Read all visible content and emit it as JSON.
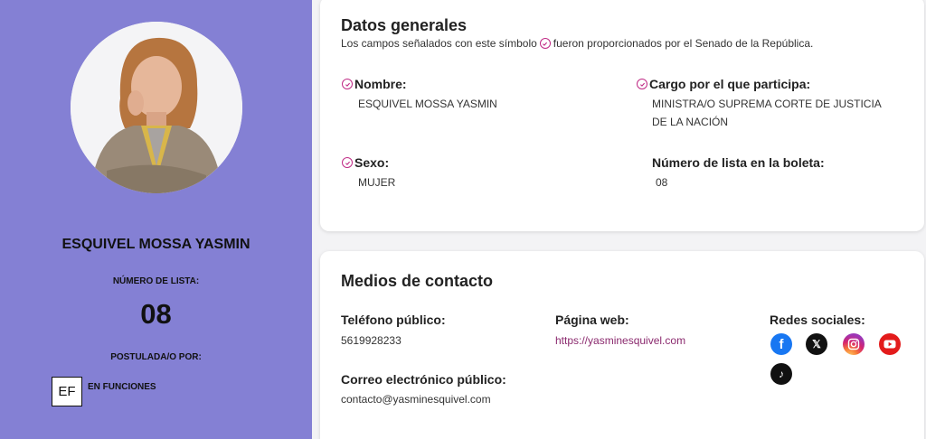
{
  "sidebar": {
    "candidate_name": "ESQUIVEL MOSSA YASMIN",
    "list_number_label": "NÚMERO DE LISTA:",
    "list_number": "08",
    "nominated_by_label": "POSTULADA/O POR:",
    "party_logo_text": "EF",
    "party_name": "EN FUNCIONES"
  },
  "general": {
    "title": "Datos generales",
    "subtitle_before": "Los campos señalados con este símbolo",
    "subtitle_after": "fueron proporcionados por el Senado de la República.",
    "name_label": "Nombre:",
    "name_value": "ESQUIVEL MOSSA YASMIN",
    "position_label": "Cargo por el que participa:",
    "position_value_line1": "MINISTRA/O SUPREMA CORTE DE JUSTICIA",
    "position_value_line2": "DE LA NACIÓN",
    "sex_label": "Sexo:",
    "sex_value": "MUJER",
    "ballot_number_label": "Número de lista en la boleta:",
    "ballot_number_value": "08"
  },
  "contact": {
    "title": "Medios de contacto",
    "phone_label": "Teléfono público:",
    "phone_value": "5619928233",
    "web_label": "Página web:",
    "web_value": "https://yasminesquivel.com",
    "social_label": "Redes sociales:",
    "email_label": "Correo electrónico público:",
    "email_value": "contacto@yasminesquivel.com",
    "social_icons": [
      "facebook-icon",
      "x-icon",
      "instagram-icon",
      "youtube-icon",
      "tiktok-icon"
    ]
  },
  "colors": {
    "sidebar_bg": "#8480d4",
    "check_accent": "#c02a85",
    "link": "#8b2a6e"
  }
}
